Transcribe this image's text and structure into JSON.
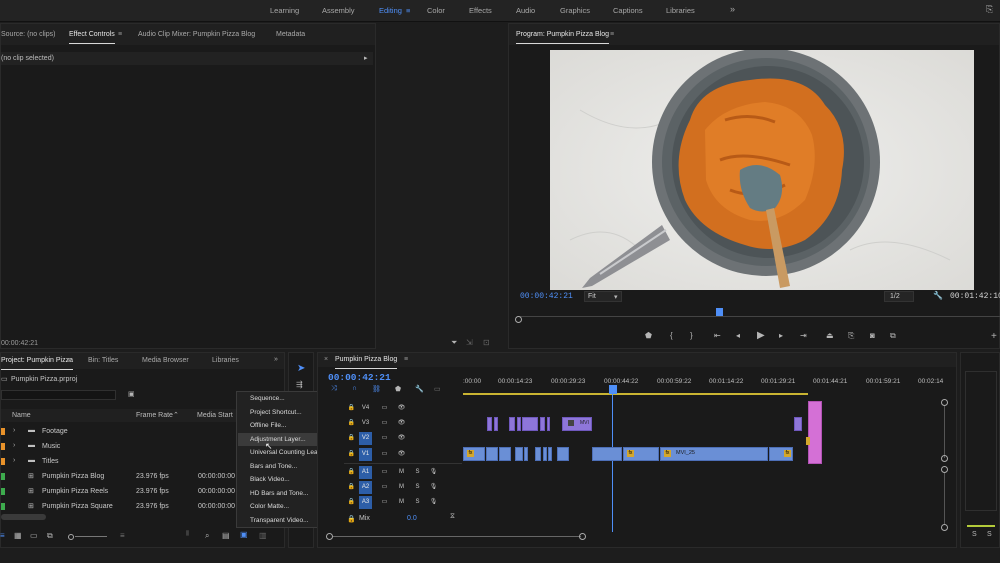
{
  "workspaces": {
    "items": [
      "Learning",
      "Assembly",
      "Editing",
      "Color",
      "Effects",
      "Audio",
      "Graphics",
      "Captions",
      "Libraries"
    ],
    "active": "Editing",
    "more": "»"
  },
  "source_panel": {
    "tabs": [
      "Source: (no clips)",
      "Effect Controls",
      "Audio Clip Mixer: Pumpkin Pizza Blog",
      "Metadata"
    ],
    "active_tab": "Effect Controls",
    "no_clip": "(no clip selected)",
    "timecode": "00:00:42:21"
  },
  "program": {
    "title": "Program: Pumpkin Pizza Blog",
    "timecode_left": "00:00:42:21",
    "fit": "Fit",
    "quality": "1/2",
    "timecode_right": "00:01:42:10"
  },
  "project_panel": {
    "tabs": [
      "Project: Pumpkin Pizza",
      "Bin: Titles",
      "Media Browser",
      "Libraries"
    ],
    "file": "Pumpkin Pizza.prproj",
    "columns": {
      "name": "Name",
      "frame_rate": "Frame Rate",
      "media_start": "Media Start"
    },
    "rows": [
      {
        "type": "folder",
        "name": "Footage",
        "fps": "",
        "start": "",
        "color": "#e8922a"
      },
      {
        "type": "folder",
        "name": "Music",
        "fps": "",
        "start": "",
        "color": "#e8922a"
      },
      {
        "type": "folder",
        "name": "Titles",
        "fps": "",
        "start": "",
        "color": "#e8922a"
      },
      {
        "type": "sequence",
        "name": "Pumpkin Pizza Blog",
        "fps": "23.976 fps",
        "start": "00:00:00:00",
        "color": "#3dab4d"
      },
      {
        "type": "sequence",
        "name": "Pumpkin Pizza Reels",
        "fps": "23.976 fps",
        "start": "00:00:00:00",
        "color": "#3dab4d"
      },
      {
        "type": "sequence",
        "name": "Pumpkin Pizza Square",
        "fps": "23.976 fps",
        "start": "00:00:00:00",
        "color": "#3dab4d"
      }
    ]
  },
  "context_menu": {
    "items": [
      "Sequence...",
      "Project Shortcut...",
      "Offline File...",
      "Adjustment Layer...",
      "Universal Counting Leader...",
      "Bars and Tone...",
      "Black Video...",
      "HD Bars and Tone...",
      "Color Matte...",
      "Transparent Video..."
    ],
    "highlighted": "Adjustment Layer..."
  },
  "timeline": {
    "sequence_name": "Pumpkin Pizza Blog",
    "timecode": "00:00:42:21",
    "ruler": [
      ":00:00",
      "00:00:14:23",
      "00:00:29:23",
      "00:00:44:22",
      "00:00:59:22",
      "00:01:14:22",
      "00:01:29:21",
      "00:01:44:21",
      "00:01:59:21",
      "00:02:14"
    ],
    "video_tracks": [
      "V4",
      "V3",
      "V2",
      "V1"
    ],
    "audio_tracks": [
      "A1",
      "A2",
      "A3"
    ],
    "mix_label": "Mix",
    "mix_value": "0.0",
    "clip_label_v2": "MVI",
    "clip_label_v1": "MVI_25",
    "fx_label": "fx"
  },
  "meters": {
    "labels": [
      "S",
      "S"
    ]
  },
  "colors": {
    "accent": "#4f8ff7",
    "purple_clip": "#8e76d9",
    "blue_clip": "#6a8fd6",
    "pink_clip": "#d470d6"
  }
}
